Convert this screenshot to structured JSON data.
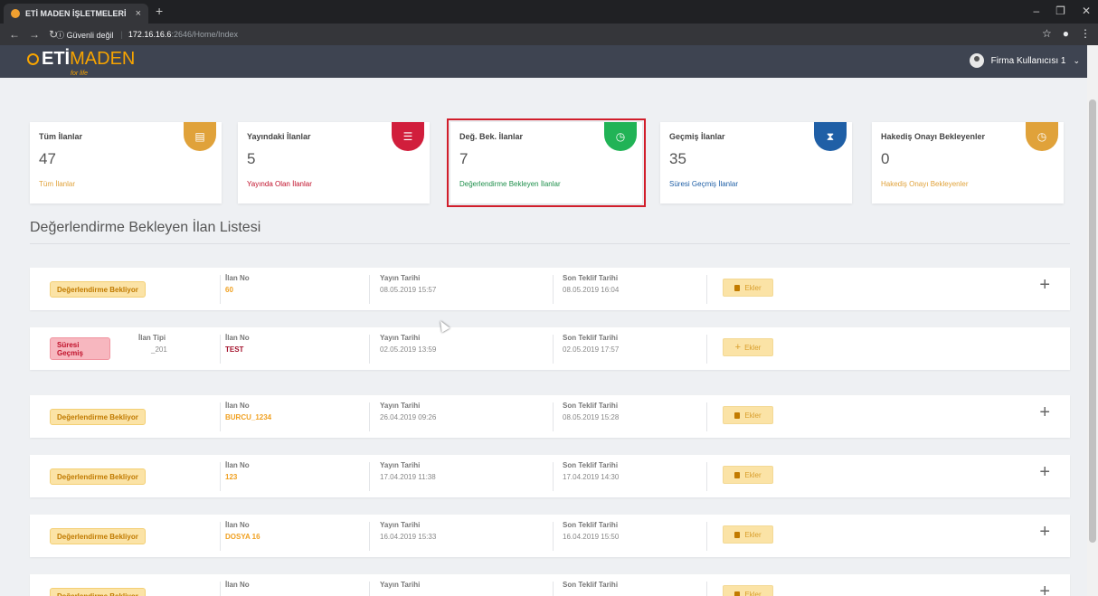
{
  "browser": {
    "tab_title": "ETİ MADEN İŞLETMELERİ",
    "tab_close": "×",
    "new_tab": "+",
    "url_info": "ⓘ Güvenli değil",
    "url_host": "172.16.16.6",
    "url_path": ":2646/Home/Index"
  },
  "app": {
    "logo_eti": "ETİ",
    "logo_maden": "MADEN",
    "logo_tag": "for life",
    "user_name": "Firma Kullanıcısı 1",
    "user_caret": "⌄"
  },
  "cards": [
    {
      "label": "Tüm İlanlar",
      "count": "47",
      "link": "Tüm İlanlar",
      "color": "#e0a23a",
      "link_color": "#e0a23a",
      "icon": "list-icon"
    },
    {
      "label": "Yayındaki İlanlar",
      "count": "5",
      "link": "Yayında Olan İlanlar",
      "color": "#d11e3c",
      "link_color": "#c0102a",
      "icon": "list-icon"
    },
    {
      "label": "Değ. Bek. İlanlar",
      "count": "7",
      "link": "Değerlendirme Bekleyen İlanlar",
      "color": "#21b356",
      "link_color": "#1e8f4b",
      "icon": "clock-icon"
    },
    {
      "label": "Geçmiş İlanlar",
      "count": "35",
      "link": "Süresi Geçmiş İlanlar",
      "color": "#1f5fa6",
      "link_color": "#1f5fa6",
      "icon": "hourglass-icon"
    },
    {
      "label": "Hakediş Onayı Bekleyenler",
      "count": "0",
      "link": "Hakediş Onayı Bekleyenler",
      "color": "#e0a23a",
      "link_color": "#e0a23a",
      "icon": "clock-icon"
    }
  ],
  "section_title": "Değerlendirme Bekleyen İlan Listesi",
  "labels": {
    "ilan_no": "İlan No",
    "ilan_tipi": "İlan Tipi",
    "yayin_tarihi": "Yayın Tarihi",
    "son_teklif": "Son Teklif Tarihi",
    "ekler": "Ekler",
    "expand": "+"
  },
  "rows": [
    {
      "status": "Değerlendirme Bekliyor",
      "status_type": "pending",
      "ilan_no": "60",
      "yayin": "08.05.2019 15:57",
      "son_teklif": "08.05.2019 16:04"
    },
    {
      "status": "Süresi Geçmiş",
      "status_type": "expired",
      "ilan_tipi": "_201",
      "ilan_no": "TEST",
      "yayin": "02.05.2019 13:59",
      "son_teklif": "02.05.2019 17:57"
    },
    {
      "status": "Değerlendirme Bekliyor",
      "status_type": "pending",
      "ilan_no": "BURCU_1234",
      "yayin": "26.04.2019 09:26",
      "son_teklif": "08.05.2019 15:28"
    },
    {
      "status": "Değerlendirme Bekliyor",
      "status_type": "pending",
      "ilan_no": "123",
      "yayin": "17.04.2019 11:38",
      "son_teklif": "17.04.2019 14:30"
    },
    {
      "status": "Değerlendirme Bekliyor",
      "status_type": "pending",
      "ilan_no": "DOSYA 16",
      "yayin": "16.04.2019 15:33",
      "son_teklif": "16.04.2019 15:50"
    },
    {
      "status": "Değerlendirme Bekliyor",
      "status_type": "pending",
      "ilan_no": "",
      "yayin": "",
      "son_teklif": ""
    }
  ]
}
